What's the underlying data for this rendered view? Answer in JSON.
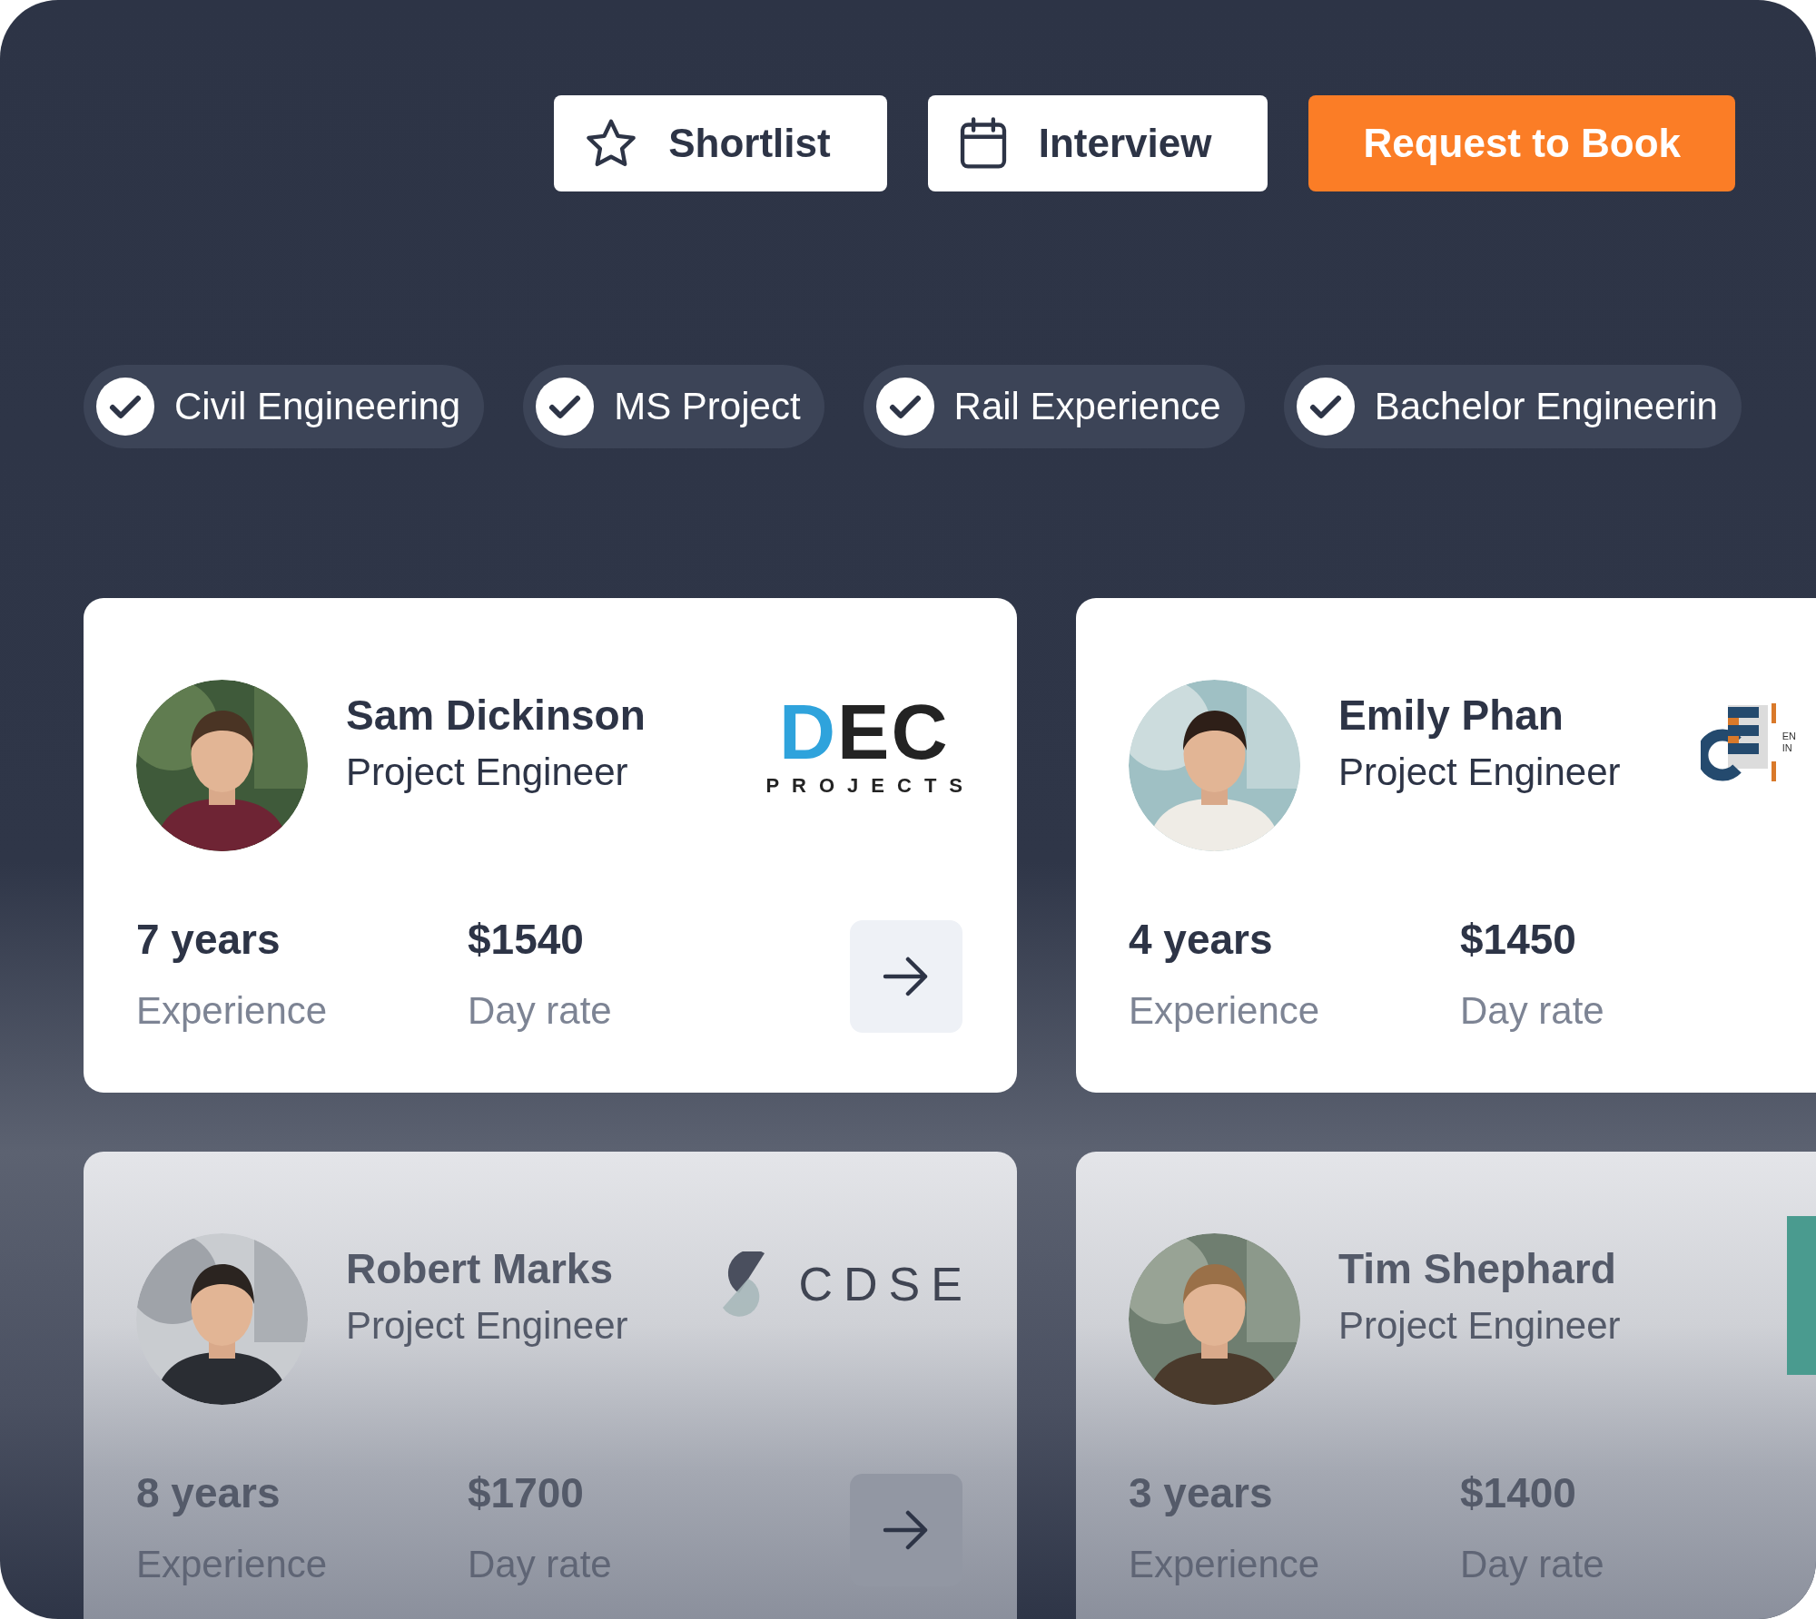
{
  "actions": [
    {
      "label": "Shortlist",
      "kind": "star"
    },
    {
      "label": "Interview",
      "kind": "calendar"
    },
    {
      "label": "Request to Book",
      "kind": "primary"
    }
  ],
  "skills": [
    {
      "label": "Civil Engineering",
      "checked": true
    },
    {
      "label": "MS Project",
      "checked": true
    },
    {
      "label": "Rail Experience",
      "checked": true
    },
    {
      "label": "Bachelor Engineerin",
      "checked": true
    }
  ],
  "candidates": [
    {
      "name": "Sam Dickinson",
      "title": "Project Engineer",
      "experience": "7 years",
      "experience_label": "Experience",
      "rate": "$1540",
      "rate_label": "Day rate",
      "arrow": true,
      "faded": false,
      "logo": {
        "kind": "dec",
        "lines": [
          "DEC",
          "PROJECTS"
        ]
      }
    },
    {
      "name": "Emily Phan",
      "title": "Project Engineer",
      "experience": "4 years",
      "experience_label": "Experience",
      "rate": "$1450",
      "rate_label": "Day rate",
      "arrow": false,
      "faded": false,
      "logo": {
        "kind": "ce",
        "lines": [
          "EN",
          "IN"
        ]
      }
    },
    {
      "name": "Robert Marks",
      "title": "Project Engineer",
      "experience": "8 years",
      "experience_label": "Experience",
      "rate": "$1700",
      "rate_label": "Day rate",
      "arrow": true,
      "faded": true,
      "logo": {
        "kind": "cdse",
        "lines": [
          "CDSE"
        ]
      }
    },
    {
      "name": "Tim Shephard",
      "title": "Project Engineer",
      "experience": "3 years",
      "experience_label": "Experience",
      "rate": "$1400",
      "rate_label": "Day rate",
      "arrow": false,
      "faded": true,
      "logo": {
        "kind": "bar"
      }
    }
  ]
}
